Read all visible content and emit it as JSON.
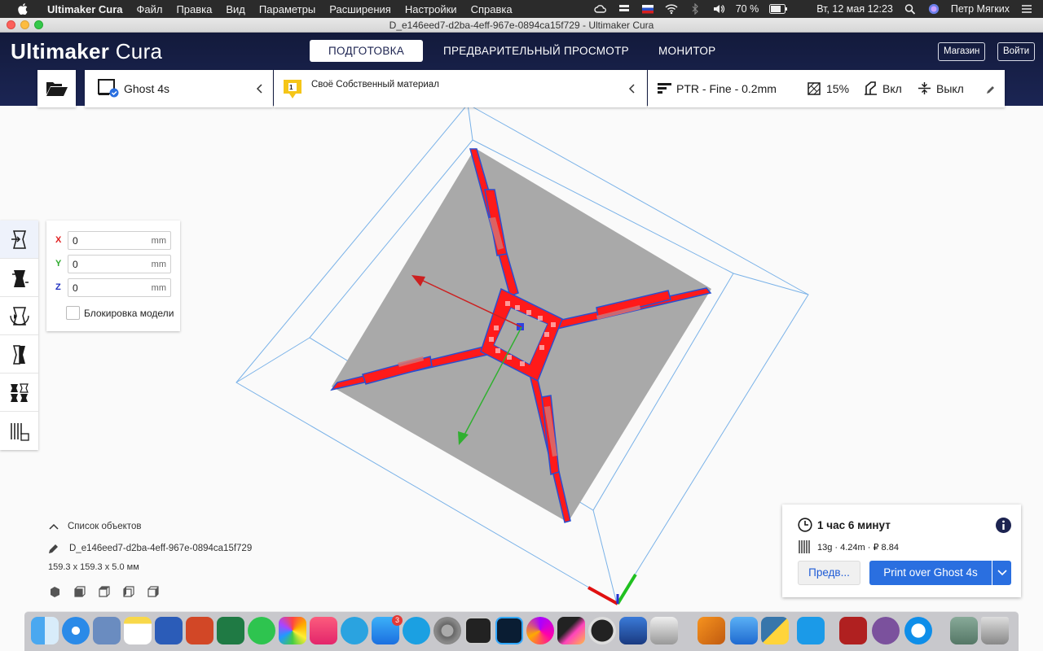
{
  "menubar": {
    "app_name": "Ultimaker Cura",
    "items": [
      "Файл",
      "Правка",
      "Вид",
      "Параметры",
      "Расширения",
      "Настройки",
      "Справка"
    ],
    "battery": "70 %",
    "datetime": "Вт, 12 мая  12:23",
    "user": "Петр Мягких"
  },
  "window": {
    "title": "D_e146eed7-d2ba-4eff-967e-0894ca15f729 - Ultimaker Cura"
  },
  "header": {
    "logo_bold": "Ultimaker",
    "logo_light": " Cura",
    "tabs": [
      {
        "label": "ПОДГОТОВКА",
        "active": true
      },
      {
        "label": "ПРЕДВАРИТЕЛЬНЫЙ ПРОСМОТР",
        "active": false
      },
      {
        "label": "МОНИТОР",
        "active": false
      }
    ],
    "marketplace": "Магазин",
    "signin": "Войти"
  },
  "settings_bar": {
    "printer": "Ghost 4s",
    "extruder_number": "1",
    "material": "Своё Собственный материал",
    "profile": "PTR - Fine - 0.2mm",
    "infill": "15%",
    "support": "Вкл",
    "adhesion": "Выкл"
  },
  "move_panel": {
    "x": {
      "label": "X",
      "value": "0",
      "unit": "mm",
      "color": "#e02020"
    },
    "y": {
      "label": "Y",
      "value": "0",
      "unit": "mm",
      "color": "#2eaa2e"
    },
    "z": {
      "label": "Z",
      "value": "0",
      "unit": "mm",
      "color": "#2030c0"
    },
    "lock_label": "Блокировка модели"
  },
  "object_list": {
    "title": "Список объектов",
    "name": "D_e146eed7-d2ba-4eff-967e-0894ca15f729",
    "dimensions": "159.3 x 159.3 x 5.0 мм"
  },
  "print_panel": {
    "time": "1 час 6 минут",
    "material_info": "13g · 4.24m · ₽ 8.84",
    "preview_label": "Предв...",
    "print_label": "Print over Ghost 4s"
  },
  "dock": {
    "badge_appstore": "3"
  },
  "colors": {
    "header_bg": "#1b2554",
    "accent_blue": "#2a6fe0",
    "model_red": "#ff1a1a",
    "build_plate": "#a9a9a9"
  }
}
